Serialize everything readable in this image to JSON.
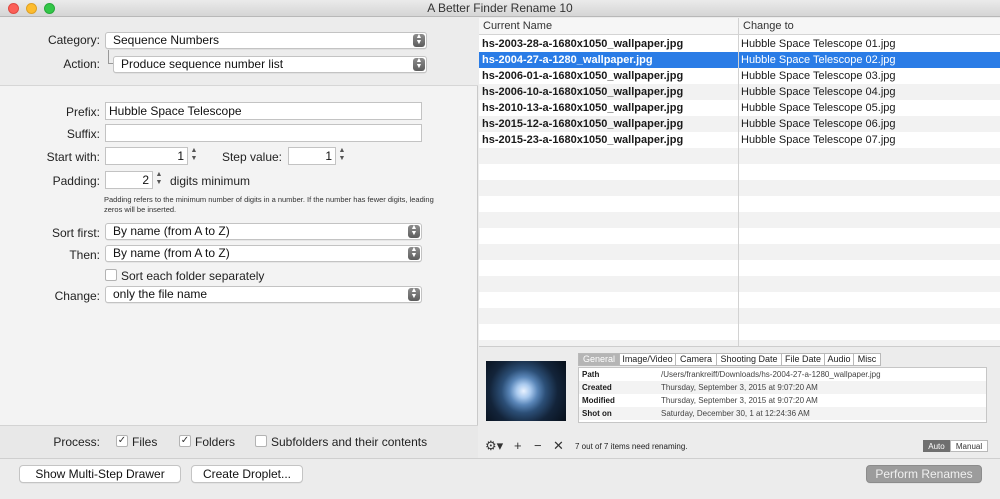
{
  "window": {
    "title": "A Better Finder Rename 10"
  },
  "left": {
    "category_label": "Category:",
    "category_value": "Sequence Numbers",
    "action_label": "Action:",
    "action_value": "Produce sequence number list",
    "prefix_label": "Prefix:",
    "prefix_value": "Hubble Space Telescope",
    "suffix_label": "Suffix:",
    "suffix_value": "",
    "start_label": "Start with:",
    "start_value": "1",
    "step_label": "Step value:",
    "step_value": "1",
    "padding_label": "Padding:",
    "padding_value": "2",
    "padding_suffix": "digits minimum",
    "padding_note": "Padding refers to the minimum number of digits in a number. If the number has fewer digits, leading zeros will be inserted.",
    "sort_first_label": "Sort first:",
    "sort_first_value": "By name (from A to Z)",
    "then_label": "Then:",
    "then_value": "By name (from A to Z)",
    "sort_folder_label": "Sort each folder separately",
    "change_label": "Change:",
    "change_value": "only the file name",
    "process_label": "Process:",
    "files_label": "Files",
    "folders_label": "Folders",
    "subfolders_label": "Subfolders and their contents"
  },
  "list": {
    "headers": [
      "Current Name",
      "Change to"
    ],
    "rows": [
      {
        "current": "hs-2003-28-a-1680x1050_wallpaper.jpg",
        "new": "Hubble Space Telescope 01.jpg"
      },
      {
        "current": "hs-2004-27-a-1280_wallpaper.jpg",
        "new": "Hubble Space Telescope 02.jpg"
      },
      {
        "current": "hs-2006-01-a-1680x1050_wallpaper.jpg",
        "new": "Hubble Space Telescope 03.jpg"
      },
      {
        "current": "hs-2006-10-a-1680x1050_wallpaper.jpg",
        "new": "Hubble Space Telescope 04.jpg"
      },
      {
        "current": "hs-2010-13-a-1680x1050_wallpaper.jpg",
        "new": "Hubble Space Telescope 05.jpg"
      },
      {
        "current": "hs-2015-12-a-1680x1050_wallpaper.jpg",
        "new": "Hubble Space Telescope 06.jpg"
      },
      {
        "current": "hs-2015-23-a-1680x1050_wallpaper.jpg",
        "new": "Hubble Space Telescope 07.jpg"
      }
    ]
  },
  "info": {
    "tabs": [
      "General",
      "Image/Video",
      "Camera",
      "Shooting Date",
      "File Date",
      "Audio",
      "Misc"
    ],
    "rows": [
      {
        "k": "Path",
        "v": "/Users/frankreiff/Downloads/hs-2004-27-a-1280_wallpaper.jpg"
      },
      {
        "k": "Created",
        "v": "Thursday, September 3, 2015 at 9:07:20 AM"
      },
      {
        "k": "Modified",
        "v": "Thursday, September 3, 2015 at 9:07:20 AM"
      },
      {
        "k": "Shot on",
        "v": "Saturday, December 30, 1 at 12:24:36 AM"
      }
    ]
  },
  "toolbar": {
    "status": "7 out of 7 items need renaming.",
    "auto_label": "Auto",
    "manual_label": "Manual"
  },
  "bottom": {
    "multistep_label": "Show Multi-Step Drawer",
    "droplet_label": "Create Droplet...",
    "perform_label": "Perform Renames"
  },
  "colors": {
    "selection": "#2a7ce6",
    "disabled_button": "#9c9c9c"
  }
}
